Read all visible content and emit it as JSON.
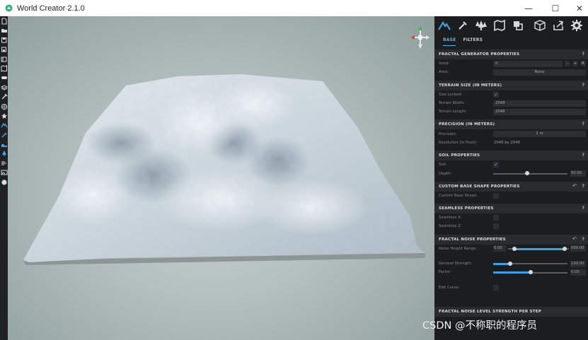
{
  "window": {
    "title": "World Creator 2.1.0",
    "minimize": "—",
    "maximize": "☐",
    "close": "✕"
  },
  "left_toolbar": {
    "icons": [
      "new-file-icon",
      "open-folder-icon",
      "save-icon",
      "save-as-icon",
      "export-icon",
      "map-icon",
      "game-controller-icon",
      "layers-icon",
      "tools-icon",
      "globe-icon",
      "star-icon",
      "mountain-icon",
      "brush-icon",
      "water-icon",
      "tree-icon",
      "wind-icon",
      "image-icon",
      "sphere-icon"
    ]
  },
  "panel": {
    "tabs": [
      {
        "label": "BASE",
        "active": true
      },
      {
        "label": "FILTERS",
        "active": false
      }
    ],
    "accent": "#5ab0e8",
    "fractal_generator": {
      "title": "FRACTAL GENERATOR PROPERTIES",
      "help": "?",
      "seed_label": "Seed:",
      "seed_value": "0",
      "seed_minus": "-",
      "seed_plus": "+",
      "seed_random": "R",
      "area_label": "Area:",
      "area_value": "None"
    },
    "terrain_size": {
      "title": "TERRAIN SIZE (IN METERS)",
      "help": "?",
      "size_locked_label": "Size Locked:",
      "size_locked": "✓",
      "width_label": "Terrain Width:",
      "width_value": "2048",
      "length_label": "Terrain Length:",
      "length_value": "2048"
    },
    "precision": {
      "title": "PRECISION (IN METERS)",
      "help": "?",
      "precision_label": "Precision:",
      "precision_value": "1 m",
      "resolution_label": "Resolution (in Pixel):",
      "resolution_value": "2048 by 2048"
    },
    "soil": {
      "title": "SOIL PROPERTIES",
      "help": "?",
      "soil_label": "Soil:",
      "soil_checked": "✓",
      "depth_label": "Depth:",
      "depth_value": "50.00",
      "depth_fraction": 0.46
    },
    "custom_base": {
      "title": "CUSTOM BASE SHAPE PROPERTIES",
      "undo": "↶",
      "help": "?",
      "label": "Custom Base Shape:"
    },
    "seamless": {
      "title": "SEAMLESS PROPERTIES",
      "help": "?",
      "x_label": "Seamless X:",
      "z_label": "Seamless Z:"
    },
    "fractal_noise": {
      "title": "FRACTAL NOISE PROPERTIES",
      "undo": "↶",
      "help": "?",
      "height_label": "Noise Height Range:",
      "height_min": "0.00",
      "height_max": "500.00",
      "height_range": [
        0.1,
        0.93
      ],
      "strength_label": "General Strength:",
      "strength_value": "100.00",
      "strength_fraction": 0.23,
      "factor_label": "Factor:",
      "factor_value": "0.05",
      "factor_fraction": 0.5,
      "curve_label": "Edit Curve:"
    },
    "next_section": {
      "title": "FRACTAL NOISE LEVEL STRENGTH PER STEP"
    }
  },
  "watermark": "CSDN @不称职的程序员"
}
